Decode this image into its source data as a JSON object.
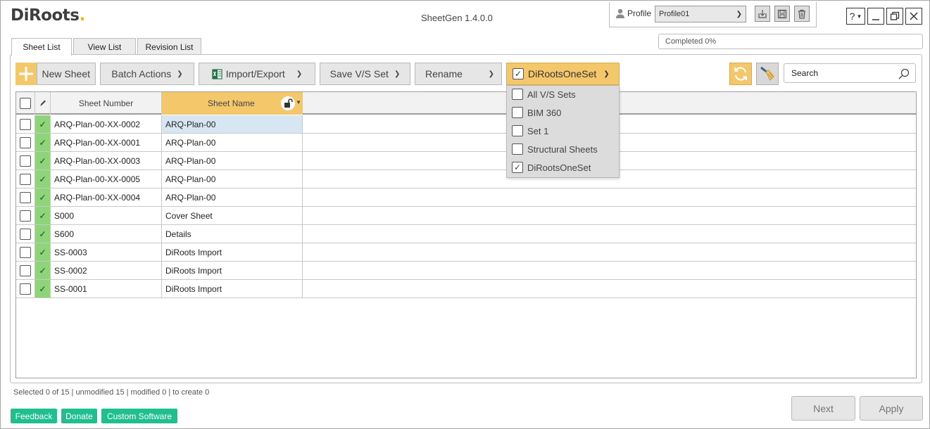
{
  "app": {
    "logo_main": "DiRoots",
    "window_title": "SheetGen 1.4.0.0"
  },
  "profile": {
    "label": "Profile",
    "selected": "Profile01"
  },
  "window_buttons": {
    "help": "?"
  },
  "tabs": [
    {
      "label": "Sheet List"
    },
    {
      "label": "View List"
    },
    {
      "label": "Revision List"
    }
  ],
  "progress": {
    "text": "Completed 0%",
    "percent": 0
  },
  "toolbar": {
    "new_sheet": "New Sheet",
    "batch_actions": "Batch Actions",
    "import_export": "Import/Export",
    "save_vs_set": "Save V/S Set",
    "rename": "Rename",
    "set_selector": "DiRootsOneSet",
    "search_placeholder": "Search"
  },
  "dropdown": {
    "items": [
      {
        "label": "All V/S Sets",
        "checked": false
      },
      {
        "label": "BIM 360",
        "checked": false
      },
      {
        "label": "Set 1",
        "checked": false
      },
      {
        "label": "Structural Sheets",
        "checked": false
      },
      {
        "label": "DiRootsOneSet",
        "checked": true
      }
    ]
  },
  "table": {
    "columns": {
      "number": "Sheet Number",
      "name": "Sheet Name"
    },
    "rows": [
      {
        "number": "ARQ-Plan-00-XX-0002",
        "name": "ARQ-Plan-00",
        "selected": true
      },
      {
        "number": "ARQ-Plan-00-XX-0001",
        "name": "ARQ-Plan-00"
      },
      {
        "number": "ARQ-Plan-00-XX-0003",
        "name": "ARQ-Plan-00"
      },
      {
        "number": "ARQ-Plan-00-XX-0005",
        "name": "ARQ-Plan-00"
      },
      {
        "number": "ARQ-Plan-00-XX-0004",
        "name": "ARQ-Plan-00"
      },
      {
        "number": "S000",
        "name": "Cover Sheet"
      },
      {
        "number": "S600",
        "name": "Details"
      },
      {
        "number": "SS-0003",
        "name": "DiRoots Import"
      },
      {
        "number": "SS-0002",
        "name": "DiRoots Import"
      },
      {
        "number": "SS-0001",
        "name": "DiRoots Import"
      }
    ]
  },
  "status": {
    "text": "Selected 0 of 15 | unmodified 15 | modified 0 | to create 0"
  },
  "footer": {
    "feedback": "Feedback",
    "donate": "Donate",
    "custom": "Custom Software",
    "next": "Next",
    "apply": "Apply"
  },
  "colors": {
    "accent": "#f4c76a",
    "status_green": "#8fd47a",
    "footer_green": "#1fbf8f",
    "row_selected": "#d6e6f3"
  }
}
